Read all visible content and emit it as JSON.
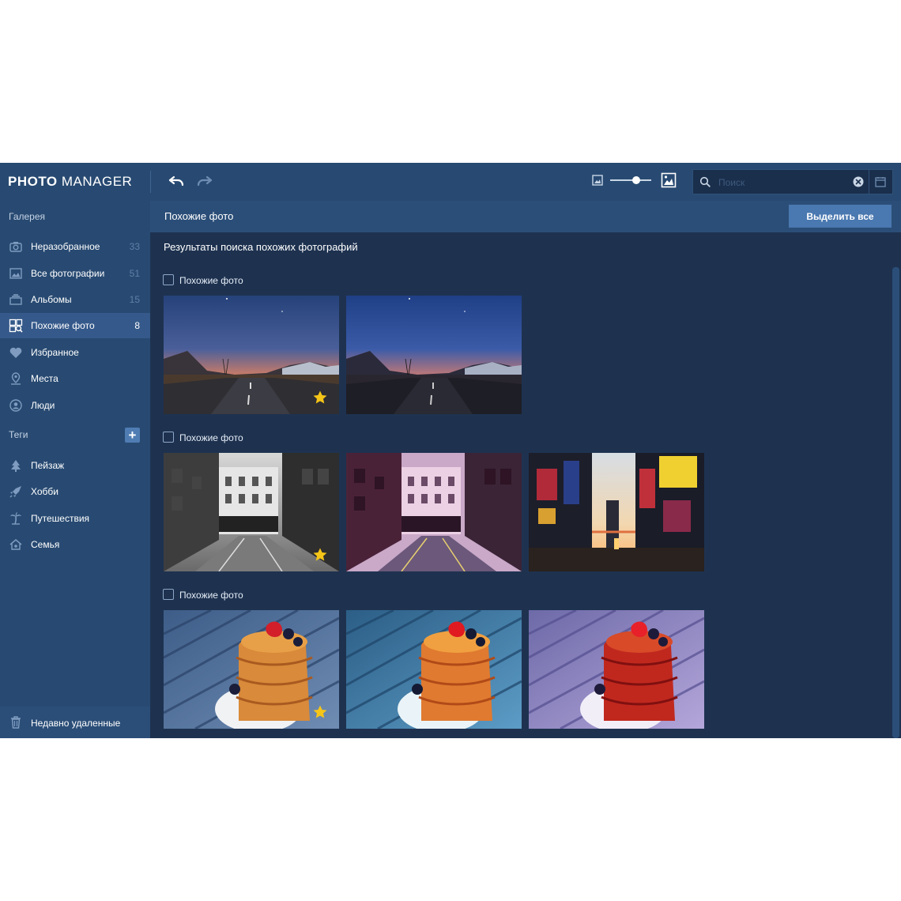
{
  "app": {
    "logo_bold": "PHOTO",
    "logo_thin": "MANAGER"
  },
  "toolbar": {
    "search_placeholder": "Поиск"
  },
  "sidebar": {
    "gallery_title": "Галерея",
    "items": [
      {
        "label": "Неразобранное",
        "count": "33",
        "icon": "camera-icon"
      },
      {
        "label": "Все фотографии",
        "count": "51",
        "icon": "photos-icon"
      },
      {
        "label": "Альбомы",
        "count": "15",
        "icon": "albums-icon"
      },
      {
        "label": "Похожие фото",
        "count": "8",
        "icon": "similar-photos-icon",
        "active": true
      },
      {
        "label": "Избранное",
        "count": "",
        "icon": "heart-icon"
      },
      {
        "label": "Места",
        "count": "",
        "icon": "location-pin-icon"
      },
      {
        "label": "Люди",
        "count": "",
        "icon": "person-icon"
      }
    ],
    "tags_title": "Теги",
    "add_tag_label": "+",
    "tags": [
      {
        "label": "Пейзаж",
        "icon": "tree-icon"
      },
      {
        "label": "Хобби",
        "icon": "rocket-icon"
      },
      {
        "label": "Путешествия",
        "icon": "palm-tree-icon"
      },
      {
        "label": "Семья",
        "icon": "house-icon"
      }
    ],
    "trash_label": "Недавно удаленные"
  },
  "main": {
    "title": "Похожие фото",
    "select_all_label": "Выделить все",
    "results_title": "Результаты поиска похожих фотографий",
    "groups": [
      {
        "label": "Похожие фото",
        "photos": [
          {
            "kind": "road-sunset",
            "starred": true
          },
          {
            "kind": "road-sunset",
            "starred": false
          }
        ]
      },
      {
        "label": "Похожие фото",
        "photos": [
          {
            "kind": "street-bw",
            "starred": true
          },
          {
            "kind": "street-purple",
            "starred": false
          },
          {
            "kind": "city-night",
            "starred": false
          }
        ]
      },
      {
        "label": "Похожие фото",
        "photos": [
          {
            "kind": "pancakes-blue",
            "starred": true
          },
          {
            "kind": "pancakes-teal",
            "starred": false
          },
          {
            "kind": "pancakes-purple",
            "starred": false
          }
        ]
      }
    ]
  },
  "colors": {
    "app_bg": "#1e3250",
    "sidebar_bg": "#284a72",
    "active_item": "#35598a",
    "accent_button": "#4a78b0",
    "star": "#f5c518"
  }
}
